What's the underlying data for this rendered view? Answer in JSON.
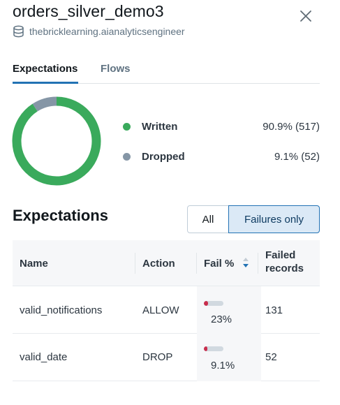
{
  "header": {
    "title": "orders_silver_demo3",
    "subtitle": "thebricklearning.aianalyticsengineer"
  },
  "tabs": [
    {
      "label": "Expectations",
      "active": true
    },
    {
      "label": "Flows",
      "active": false
    }
  ],
  "summary": {
    "written": {
      "label": "Written",
      "value": "90.9% (517)",
      "count": 517,
      "fraction": 0.909,
      "color": "#3aaa5c"
    },
    "dropped": {
      "label": "Dropped",
      "value": "9.1% (52)",
      "count": 52,
      "fraction": 0.091,
      "color": "#8596a6"
    }
  },
  "expectations": {
    "heading": "Expectations",
    "filter": {
      "all_label": "All",
      "failures_label": "Failures only",
      "selected": "Failures only"
    },
    "columns": {
      "name": "Name",
      "action": "Action",
      "fail": "Fail %",
      "failed_line1": "Failed",
      "failed_line2": "records"
    },
    "rows": [
      {
        "name": "valid_notifications",
        "action": "ALLOW",
        "fail_pct": "23%",
        "fail_fraction": 0.23,
        "failed_records": "131"
      },
      {
        "name": "valid_date",
        "action": "DROP",
        "fail_pct": "9.1%",
        "fail_fraction": 0.091,
        "failed_records": "52"
      }
    ]
  },
  "colors": {
    "accent": "#2272b4",
    "fail_bar": "#c82d4c"
  }
}
